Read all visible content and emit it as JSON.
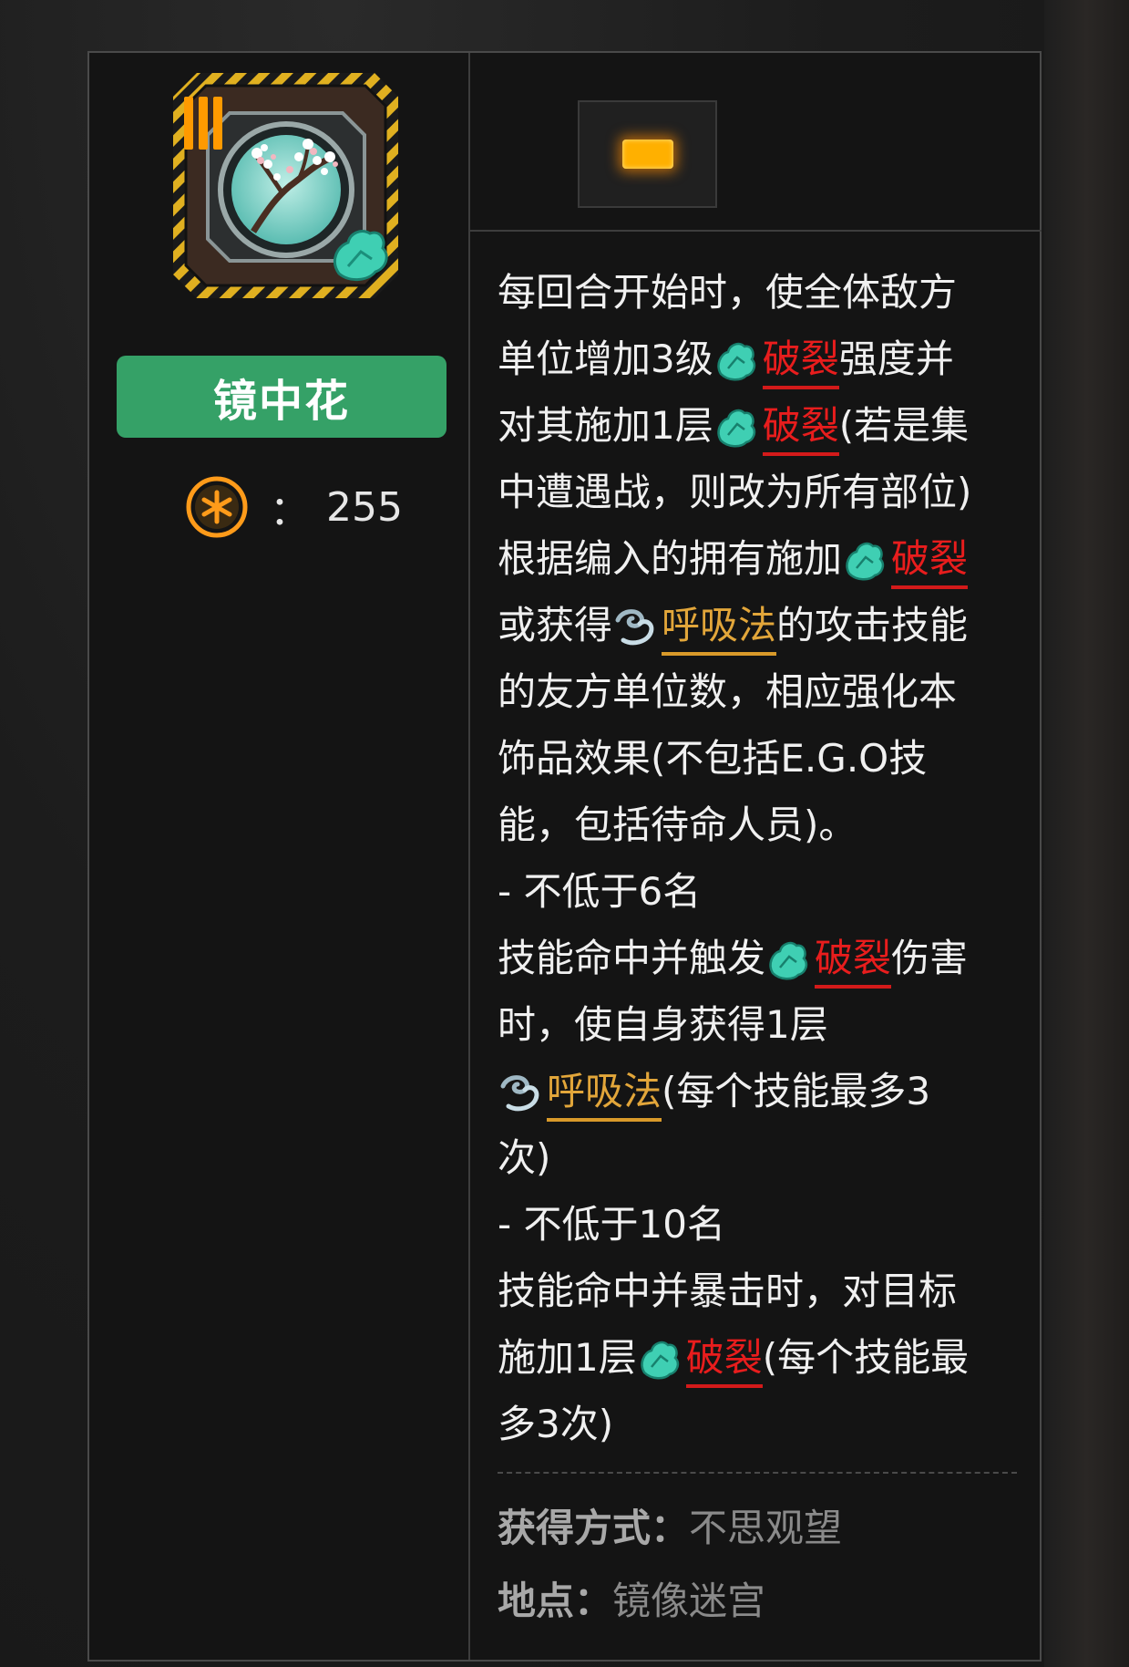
{
  "item": {
    "name": "镜中花",
    "tier_numeral": "III",
    "cost_separator": "：",
    "cost": "255",
    "cost_icon": "cost-coin-icon"
  },
  "tier": {
    "icon": "tier-bar-icon",
    "color": "#ffb000"
  },
  "keywords": {
    "rupture": "破裂",
    "breath": "呼吸法",
    "rupture_color": "#e81d1d",
    "breath_color": "#e2a63a"
  },
  "description": {
    "l1": "每回合开始时，使全体敌方",
    "l2a": "单位增加3级",
    "l2b": "强度并",
    "l3a": "对其施加1层",
    "l3b": "(若是集",
    "l4": "中遭遇战，则改为所有部位)",
    "l5a": "根据编入的拥有施加",
    "l6a": "或获得",
    "l6b": "的攻击技能",
    "l7": "的友方单位数，相应强化本",
    "l8": "饰品效果(不包括E.G.O技",
    "l9": "能，包括待命人员)。",
    "l10": "- 不低于6名",
    "l11a": "技能命中并触发",
    "l11b": "伤害",
    "l12": "时，使自身获得1层",
    "l13b": "(每个技能最多3",
    "l14": "次)",
    "l15": "- 不低于10名",
    "l16": "技能命中并暴击时，对目标",
    "l17a": "施加1层",
    "l17b": "(每个技能最",
    "l18": "多3次)"
  },
  "acquire": {
    "method_label": "获得方式：",
    "method_value": "不思观望",
    "location_label": "地点：",
    "location_value": "镜像迷宫"
  },
  "colors": {
    "name_pill": "#35a167",
    "panel_bg": "#141414"
  }
}
